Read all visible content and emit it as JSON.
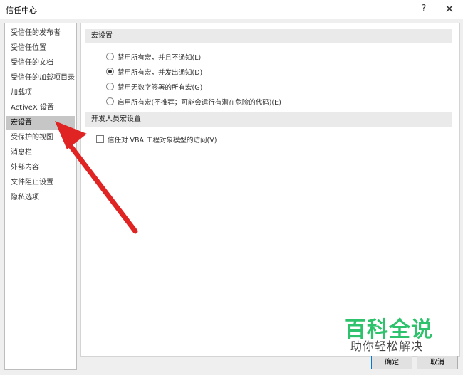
{
  "window": {
    "title": "信任中心",
    "help_label": "?",
    "close_label": "✕"
  },
  "sidebar": {
    "items": [
      {
        "label": "受信任的发布者"
      },
      {
        "label": "受信任位置"
      },
      {
        "label": "受信任的文档"
      },
      {
        "label": "受信任的加载项目录"
      },
      {
        "label": "加载项"
      },
      {
        "label": "ActiveX 设置"
      },
      {
        "label": "宏设置",
        "active": true
      },
      {
        "label": "受保护的视图"
      },
      {
        "label": "消息栏"
      },
      {
        "label": "外部内容"
      },
      {
        "label": "文件阻止设置"
      },
      {
        "label": "隐私选项"
      }
    ]
  },
  "main": {
    "macro_section": {
      "header": "宏设置",
      "options": [
        {
          "label": "禁用所有宏，并且不通知(L)",
          "checked": false
        },
        {
          "label": "禁用所有宏，并发出通知(D)",
          "checked": true
        },
        {
          "label": "禁用无数字签署的所有宏(G)",
          "checked": false
        },
        {
          "label": "启用所有宏(不推荐；可能会运行有潜在危险的代码)(E)",
          "checked": false
        }
      ]
    },
    "developer_section": {
      "header": "开发人员宏设置",
      "checkbox": {
        "label": "信任对 VBA 工程对象模型的访问(V)",
        "checked": false
      }
    }
  },
  "footer": {
    "ok_label": "确定",
    "cancel_label": "取消"
  },
  "watermark": {
    "title": "百科全说",
    "subtitle": "助你轻松解决"
  },
  "colors": {
    "arrow": "#e02424",
    "watermark_green": "#2dc26b",
    "selected_item": "#c6c6c6"
  }
}
